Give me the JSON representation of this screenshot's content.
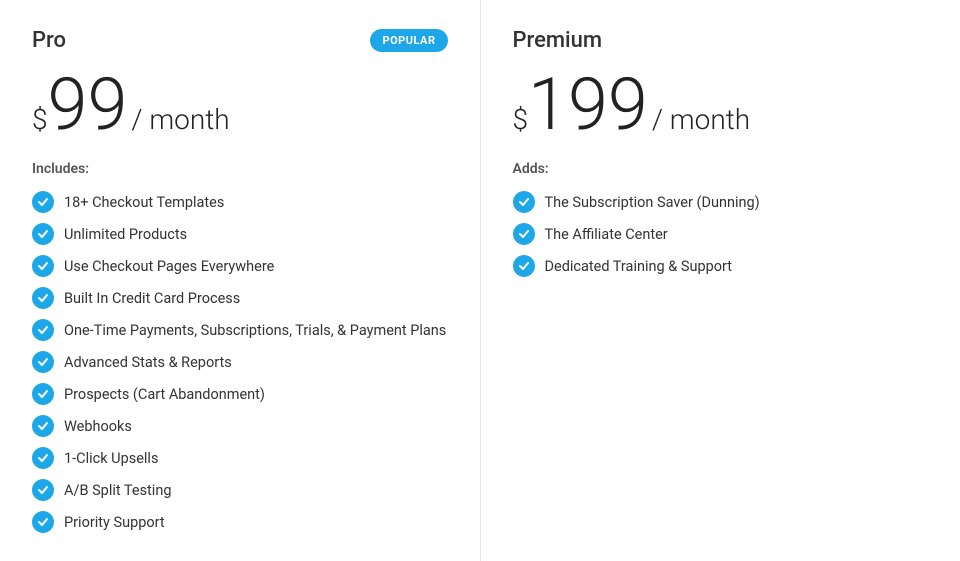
{
  "plans": [
    {
      "id": "pro",
      "name": "Pro",
      "popular": true,
      "popular_label": "POPULAR",
      "price_dollar": "$",
      "price_amount": "99",
      "price_period": "/ month",
      "includes_label": "Includes:",
      "features": [
        "18+ Checkout Templates",
        "Unlimited Products",
        "Use Checkout Pages Everywhere",
        "Built In Credit Card Process",
        "One-Time Payments, Subscriptions, Trials, & Payment Plans",
        "Advanced Stats & Reports",
        "Prospects (Cart Abandonment)",
        "Webhooks",
        "1-Click Upsells",
        "A/B Split Testing",
        "Priority Support"
      ]
    },
    {
      "id": "premium",
      "name": "Premium",
      "popular": false,
      "popular_label": "",
      "price_dollar": "$",
      "price_amount": "199",
      "price_period": "/ month",
      "includes_label": "Adds:",
      "features": [
        "The Subscription Saver (Dunning)",
        "The Affiliate Center",
        "Dedicated Training & Support"
      ]
    }
  ]
}
